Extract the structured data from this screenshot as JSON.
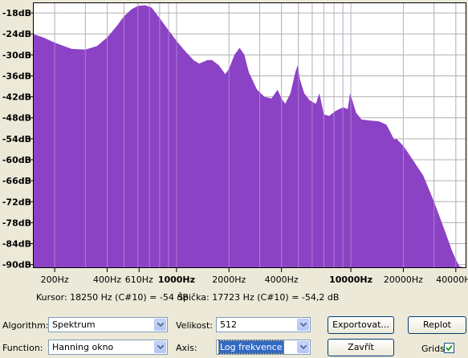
{
  "chart_data": {
    "type": "area",
    "title": "",
    "xlabel": "",
    "ylabel": "",
    "x_scale": "log",
    "y_unit": "dB",
    "xlim": [
      150,
      46000
    ],
    "ylim": [
      -91,
      -15
    ],
    "y_ticks": [
      -18,
      -24,
      -30,
      -36,
      -42,
      -48,
      -54,
      -60,
      -66,
      -72,
      -78,
      -84,
      -90
    ],
    "y_tick_labels": [
      "-18dB",
      "-24dB",
      "-30dB",
      "-36dB",
      "-42dB",
      "-48dB",
      "-54dB",
      "-60dB",
      "-66dB",
      "-72dB",
      "-78dB",
      "-84dB",
      "-90dB"
    ],
    "x_ticks": [
      {
        "label": "200Hz",
        "hz": 200,
        "bold": false
      },
      {
        "label": "400Hz",
        "hz": 400,
        "bold": false
      },
      {
        "label": "610Hz",
        "hz": 610,
        "bold": false
      },
      {
        "label": "1000Hz",
        "hz": 1000,
        "bold": true
      },
      {
        "label": "2000Hz",
        "hz": 2000,
        "bold": false
      },
      {
        "label": "4000Hz",
        "hz": 4000,
        "bold": false
      },
      {
        "label": "10000Hz",
        "hz": 10000,
        "bold": true
      },
      {
        "label": "20000Hz",
        "hz": 20000,
        "bold": false
      },
      {
        "label": "40000Hz",
        "hz": 40000,
        "bold": false
      }
    ],
    "grid": true,
    "fill_color": "#8b42c5",
    "series": [
      {
        "points": [
          [
            150,
            -24
          ],
          [
            172,
            -25
          ],
          [
            200,
            -26.5
          ],
          [
            250,
            -28.3
          ],
          [
            300,
            -28.5
          ],
          [
            350,
            -27.5
          ],
          [
            400,
            -25
          ],
          [
            450,
            -22
          ],
          [
            500,
            -19
          ],
          [
            550,
            -17
          ],
          [
            600,
            -16
          ],
          [
            660,
            -15.8
          ],
          [
            720,
            -16.5
          ],
          [
            800,
            -19.5
          ],
          [
            900,
            -23
          ],
          [
            1000,
            -26
          ],
          [
            1100,
            -28.5
          ],
          [
            1250,
            -31.5
          ],
          [
            1350,
            -32.5
          ],
          [
            1500,
            -31.5
          ],
          [
            1600,
            -31.5
          ],
          [
            1750,
            -33
          ],
          [
            1900,
            -35.5
          ],
          [
            2000,
            -34
          ],
          [
            2150,
            -30
          ],
          [
            2300,
            -28
          ],
          [
            2450,
            -30
          ],
          [
            2600,
            -35
          ],
          [
            2900,
            -40
          ],
          [
            3200,
            -42
          ],
          [
            3500,
            -42.5
          ],
          [
            3800,
            -40
          ],
          [
            4000,
            -42.5
          ],
          [
            4200,
            -44
          ],
          [
            4500,
            -41
          ],
          [
            4800,
            -35
          ],
          [
            4950,
            -33
          ],
          [
            5100,
            -37
          ],
          [
            5400,
            -41
          ],
          [
            5800,
            -43
          ],
          [
            6300,
            -44
          ],
          [
            6600,
            -41
          ],
          [
            7000,
            -47
          ],
          [
            7500,
            -47.5
          ],
          [
            8200,
            -46
          ],
          [
            9000,
            -45
          ],
          [
            9600,
            -45.5
          ],
          [
            9900,
            -41
          ],
          [
            10200,
            -43
          ],
          [
            10700,
            -46.5
          ],
          [
            11500,
            -48.5
          ],
          [
            13000,
            -48.8
          ],
          [
            14500,
            -49
          ],
          [
            16000,
            -50
          ],
          [
            17723,
            -54.2
          ],
          [
            18250,
            -54
          ],
          [
            20000,
            -56
          ],
          [
            23000,
            -60.5
          ],
          [
            26000,
            -64.5
          ],
          [
            30000,
            -72
          ],
          [
            35000,
            -81
          ],
          [
            38000,
            -86
          ],
          [
            40000,
            -88.5
          ],
          [
            42000,
            -90.5
          ],
          [
            46000,
            -91
          ]
        ]
      }
    ]
  },
  "status": {
    "cursor": "Kursor: 18250 Hz (C#10) = -54 dB",
    "peak": "Špička: 17723 Hz (C#10) = -54,2 dB"
  },
  "controls": {
    "algorithm_label": "Algorithm:",
    "algorithm_value": "Spektrum",
    "function_label": "Function:",
    "function_value": "Hanning okno",
    "size_label": "Velikost:",
    "size_value": "512",
    "axis_label": "Axis:",
    "axis_value": "Log frekvence",
    "export_button": "Exportovat...",
    "replot_button": "Replot",
    "close_button": "Zavřít",
    "grids_label": "Grids",
    "grids_checked": true
  }
}
